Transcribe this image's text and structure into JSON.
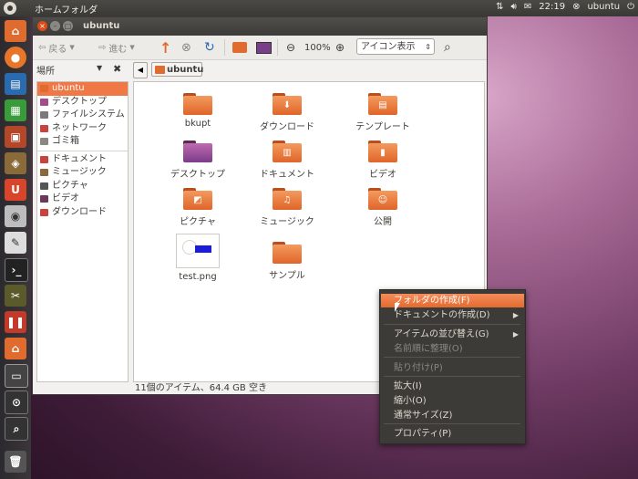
{
  "top_panel": {
    "title": "ホームフォルダ",
    "clock": "22:19",
    "user": "ubuntu"
  },
  "window": {
    "title": "ubuntu",
    "toolbar": {
      "back": "戻る",
      "forward": "進む",
      "zoom": "100%",
      "view_mode": "アイコン表示"
    },
    "sidebar_header": "場所",
    "path_crumb": "ubuntu",
    "sidebar": {
      "places": [
        {
          "label": "ubuntu",
          "color": "#e06b2f",
          "selected": true
        },
        {
          "label": "デスクトップ",
          "color": "#a24c8b"
        },
        {
          "label": "ファイルシステム",
          "color": "#7a7a7a"
        },
        {
          "label": "ネットワーク",
          "color": "#c9423b"
        },
        {
          "label": "ゴミ箱",
          "color": "#8a8883"
        }
      ],
      "bookmarks": [
        {
          "label": "ドキュメント",
          "color": "#c9423b"
        },
        {
          "label": "ミュージック",
          "color": "#8a6a3a"
        },
        {
          "label": "ピクチャ",
          "color": "#555"
        },
        {
          "label": "ビデオ",
          "color": "#6a3a5a"
        },
        {
          "label": "ダウンロード",
          "color": "#c9423b"
        }
      ]
    },
    "files": [
      {
        "label": "bkupt",
        "icon": "folder-icon"
      },
      {
        "label": "ダウンロード",
        "icon": "download-folder-icon"
      },
      {
        "label": "テンプレート",
        "icon": "template-folder-icon"
      },
      {
        "label": "デスクトップ",
        "icon": "desktop-folder-icon"
      },
      {
        "label": "ドキュメント",
        "icon": "documents-folder-icon"
      },
      {
        "label": "ビデオ",
        "icon": "video-folder-icon"
      },
      {
        "label": "ピクチャ",
        "icon": "pictures-folder-icon"
      },
      {
        "label": "ミュージック",
        "icon": "music-folder-icon"
      },
      {
        "label": "公開",
        "icon": "public-folder-icon"
      },
      {
        "label": "test.png",
        "icon": "image-thumbnail"
      },
      {
        "label": "サンプル",
        "icon": "folder-icon"
      }
    ],
    "status": "11個のアイテム、64.4 GB 空き"
  },
  "context_menu": {
    "items": [
      {
        "label": "フォルダの作成(F)",
        "state": "highlighted"
      },
      {
        "label": "ドキュメントの作成(D)",
        "submenu": true
      },
      {
        "label": "アイテムの並び替え(G)",
        "submenu": true
      },
      {
        "label": "名前順に整理(O)",
        "state": "disabled"
      },
      {
        "label": "貼り付け(P)",
        "state": "disabled"
      },
      {
        "label": "拡大(I)"
      },
      {
        "label": "縮小(O)"
      },
      {
        "label": "通常サイズ(Z)"
      },
      {
        "label": "プロパティ(P)"
      }
    ]
  }
}
